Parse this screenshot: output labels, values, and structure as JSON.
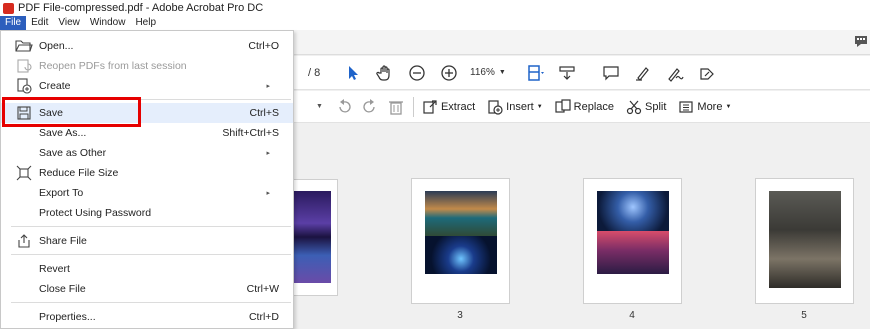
{
  "window": {
    "title": "PDF File-compressed.pdf - Adobe Acrobat Pro DC"
  },
  "menubar": {
    "items": [
      "File",
      "Edit",
      "View",
      "Window",
      "Help"
    ]
  },
  "file_menu": {
    "open": {
      "label": "Open...",
      "shortcut": "Ctrl+O"
    },
    "reopen": {
      "label": "Reopen PDFs from last session"
    },
    "create": {
      "label": "Create"
    },
    "save": {
      "label": "Save",
      "shortcut": "Ctrl+S"
    },
    "save_as": {
      "label": "Save As...",
      "shortcut": "Shift+Ctrl+S"
    },
    "save_as_other": {
      "label": "Save as Other"
    },
    "reduce_file_size": {
      "label": "Reduce File Size"
    },
    "export_to": {
      "label": "Export To"
    },
    "protect": {
      "label": "Protect Using Password"
    },
    "share_file": {
      "label": "Share File"
    },
    "revert": {
      "label": "Revert"
    },
    "close_file": {
      "label": "Close File",
      "shortcut": "Ctrl+W"
    },
    "properties": {
      "label": "Properties...",
      "shortcut": "Ctrl+D"
    },
    "submenu_arrow": "▸"
  },
  "toolbar": {
    "page_total": "/ 8",
    "zoom": "116%",
    "extract": "Extract",
    "insert": "Insert",
    "replace": "Replace",
    "split": "Split",
    "more": "More"
  },
  "pages": [
    "3",
    "4",
    "5"
  ],
  "colors": {
    "menu_active": "#2c5ebd",
    "highlight_box": "#e60000",
    "menu_hover": "#e5eefc"
  }
}
